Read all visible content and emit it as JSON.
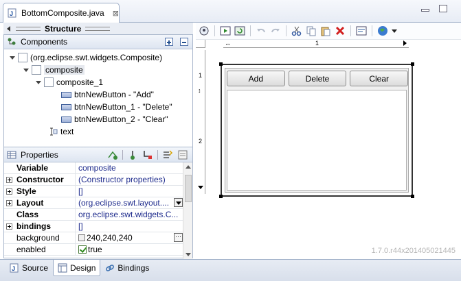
{
  "editor": {
    "tab_title": "BottomComposite.java",
    "close_glyph": "⊠"
  },
  "structure": {
    "title": "Structure"
  },
  "components": {
    "title": "Components",
    "tree": [
      {
        "label": "(org.eclipse.swt.widgets.Composite)",
        "icon": "composite-icon"
      },
      {
        "label": "composite",
        "icon": "composite-icon"
      },
      {
        "label": "composite_1",
        "icon": "composite-icon"
      },
      {
        "label": "btnNewButton - \"Add\"",
        "icon": "button-icon"
      },
      {
        "label": "btnNewButton_1 - \"Delete\"",
        "icon": "button-icon"
      },
      {
        "label": "btnNewButton_2 - \"Clear\"",
        "icon": "button-icon"
      },
      {
        "label": "text",
        "icon": "text-icon"
      }
    ]
  },
  "properties": {
    "title": "Properties",
    "rows": [
      {
        "name": "Variable",
        "value": "composite"
      },
      {
        "name": "Constructor",
        "value": "(Constructor properties)"
      },
      {
        "name": "Style",
        "value": "[]"
      },
      {
        "name": "Layout",
        "value": "(org.eclipse.swt.layout...."
      },
      {
        "name": "Class",
        "value": "org.eclipse.swt.widgets.C..."
      },
      {
        "name": "bindings",
        "value": "[]"
      },
      {
        "name": "background",
        "value": "240,240,240"
      },
      {
        "name": "enabled",
        "value": "true"
      }
    ]
  },
  "ruler": {
    "top_label": "1",
    "left_1": "1",
    "left_2": "2"
  },
  "canvas": {
    "buttons": [
      "Add",
      "Delete",
      "Clear"
    ]
  },
  "version": "1.7.0.r44x201405021445",
  "bottom_tabs": [
    {
      "label": "Source"
    },
    {
      "label": "Design"
    },
    {
      "label": "Bindings"
    }
  ],
  "colors": {
    "accent": "#1d2a8c",
    "panel_header": "#dde5f1"
  }
}
